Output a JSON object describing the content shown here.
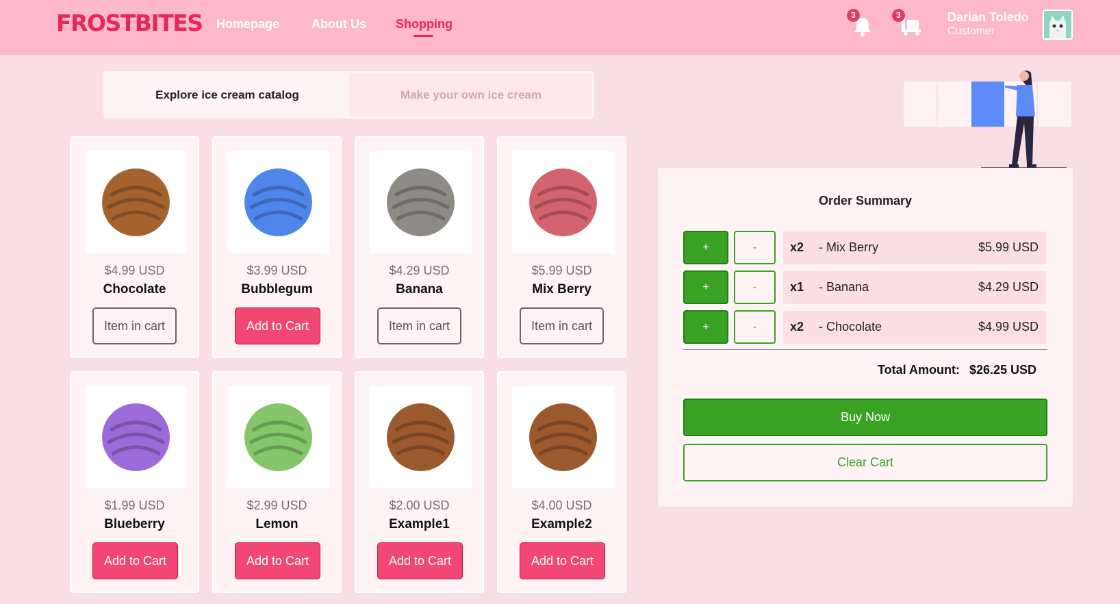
{
  "brand": {
    "logo": "FROSTBITES",
    "accent": "#e8265a"
  },
  "nav": {
    "items": [
      {
        "label": "Homepage"
      },
      {
        "label": "About Us"
      },
      {
        "label": "Shopping",
        "active": true
      }
    ]
  },
  "header": {
    "notifications": {
      "icon": "bell-icon",
      "count": "3"
    },
    "cart": {
      "icon": "cart-icon",
      "count": "3"
    },
    "user": {
      "name": "Darian Toledo",
      "role": "Customer"
    }
  },
  "tabs": [
    {
      "label": "Explore ice cream catalog",
      "active": true
    },
    {
      "label": "Make your own ice cream",
      "active": false
    }
  ],
  "products": [
    {
      "price": "$4.99 USD",
      "name": "Chocolate",
      "button": "Item in cart",
      "in_cart": true,
      "color": "#a4622e"
    },
    {
      "price": "$3.99 USD",
      "name": "Bubblegum",
      "button": "Add to Cart",
      "in_cart": false,
      "color": "#4f86ec"
    },
    {
      "price": "$4.29 USD",
      "name": "Banana",
      "button": "Item in cart",
      "in_cart": true,
      "color": "#8e8a86"
    },
    {
      "price": "$5.99 USD",
      "name": "Mix Berry",
      "button": "Item in cart",
      "in_cart": true,
      "color": "#d3636f"
    },
    {
      "price": "$1.99 USD",
      "name": "Blueberry",
      "button": "Add to Cart",
      "in_cart": false,
      "color": "#9c6bd9"
    },
    {
      "price": "$2.99 USD",
      "name": "Lemon",
      "button": "Add to Cart",
      "in_cart": false,
      "color": "#85c66a"
    },
    {
      "price": "$2.00 USD",
      "name": "Example1",
      "button": "Add to Cart",
      "in_cart": false,
      "color": "#9a5a2e"
    },
    {
      "price": "$4.00 USD",
      "name": "Example2",
      "button": "Add to Cart",
      "in_cart": false,
      "color": "#9a5a2e"
    }
  ],
  "order_summary": {
    "title": "Order Summary",
    "plus_label": "+",
    "minus_label": "-",
    "lines": [
      {
        "qty": "x2",
        "name": "- Mix Berry",
        "price": "$5.99 USD"
      },
      {
        "qty": "x1",
        "name": "- Banana",
        "price": "$4.29 USD"
      },
      {
        "qty": "x2",
        "name": "- Chocolate",
        "price": "$4.99 USD"
      }
    ],
    "total_label": "Total Amount:",
    "total_value": "$26.25 USD",
    "buy_label": "Buy Now",
    "clear_label": "Clear Cart",
    "buy_color": "#3aa324"
  }
}
